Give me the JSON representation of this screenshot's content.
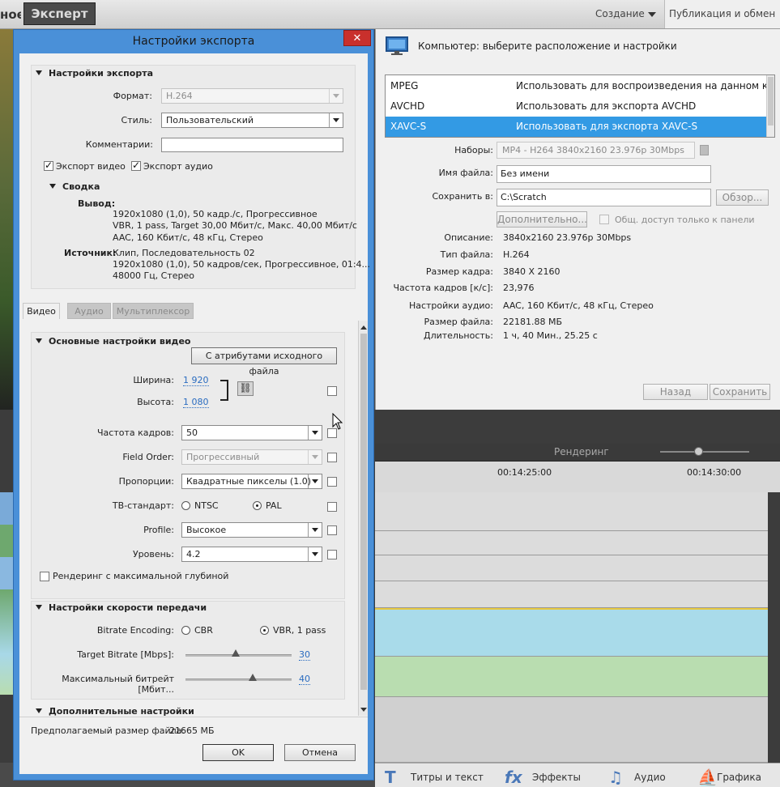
{
  "app": {
    "mode_prev": "ное",
    "mode_expert": "Эксперт",
    "menu_create": "Создание",
    "menu_publish": "Публикация и обмен"
  },
  "publish_panel": {
    "title": "Компьютер: выберите расположение и настройки",
    "presets": [
      {
        "name": "MPEG",
        "desc": "Использовать для воспроизведения на данном компьютере",
        "selected": false
      },
      {
        "name": "AVCHD",
        "desc": "Использовать для экспорта AVCHD",
        "selected": false
      },
      {
        "name": "XAVC-S",
        "desc": "Использовать для экспорта XAVC-S",
        "selected": true
      }
    ],
    "presets_label": "Наборы:",
    "presets_value": "MP4 - H264 3840x2160 23.976p 30Mbps",
    "filename_label": "Имя файла:",
    "filename_value": "Без имени",
    "saveto_label": "Сохранить в:",
    "saveto_value": "C:\\Scratch",
    "browse_button": "Обзор...",
    "advanced_button": "Дополнительно...",
    "share_only_label": "Общ. доступ только к панели",
    "info": [
      {
        "label": "Описание:",
        "value": "3840x2160 23.976p 30Mbps"
      },
      {
        "label": "Тип файла:",
        "value": "H.264"
      },
      {
        "label": "Размер кадра:",
        "value": "3840 X 2160"
      },
      {
        "label": "Частота кадров [к/с]:",
        "value": "23,976"
      },
      {
        "label": "Настройки аудио:",
        "value": "AAC, 160 Кбит/с, 48 кГц, Стерео"
      },
      {
        "label": "Размер файла:",
        "value": "22181.88 МБ"
      },
      {
        "label": "Длительность:",
        "value": "1 ч, 40 Мин., 25.25 с"
      }
    ],
    "back_button": "Назад",
    "save_button": "Сохранить"
  },
  "timeline": {
    "render_label": "Рендеринг",
    "time_1": "00:14:25:00",
    "time_2": "00:14:30:00"
  },
  "bottom_bar": {
    "titles": "Титры и текст",
    "effects": "Эффекты",
    "audio": "Аудио",
    "graphics": "Графика"
  },
  "dialog": {
    "title": "Настройки экспорта",
    "close": "✕",
    "export_settings_title": "Настройки экспорта",
    "format_label": "Формат:",
    "format_value": "H.264",
    "style_label": "Стиль:",
    "style_value": "Пользовательский",
    "comment_label": "Комментарии:",
    "comment_value": "",
    "export_video_label": "Экспорт видео",
    "export_video_checked": true,
    "export_audio_label": "Экспорт аудио",
    "export_audio_checked": true,
    "summary_title": "Сводка",
    "output_label": "Вывод:",
    "output_lines": [
      "1920x1080 (1,0), 50 кадр./с, Прогрессивное",
      "VBR, 1 pass, Target 30,00 Мбит/с, Макс. 40,00 Мбит/с",
      "AAC, 160 Кбит/с, 48 кГц, Стерео"
    ],
    "source_label": "Источник:",
    "source_lines": [
      "Клип, Последовательность 02",
      "1920x1080 (1,0), 50 кадров/сек, Прогрессивное, 01:4...",
      "48000 Гц, Стерео"
    ],
    "tabs": [
      {
        "label": "Видео",
        "active": true
      },
      {
        "label": "Аудио",
        "active": false
      },
      {
        "label": "Мультиплексор",
        "active": false
      }
    ],
    "basic_video_title": "Основные настройки видео",
    "match_source_button": "С атрибутами исходного файла",
    "width_label": "Ширина:",
    "width_value": "1 920",
    "height_label": "Высота:",
    "height_value": "1 080",
    "framerate_label": "Частота кадров:",
    "framerate_value": "50",
    "field_order_label": "Field Order:",
    "field_order_value": "Прогрессивный",
    "aspect_label": "Пропорции:",
    "aspect_value": "Квадратные пикселы (1.0)",
    "tv_standard_label": "ТВ-стандарт:",
    "tv_ntsc": "NTSC",
    "tv_pal": "PAL",
    "tv_selected": "PAL",
    "profile_label": "Profile:",
    "profile_value": "Высокое",
    "level_label": "Уровень:",
    "level_value": "4.2",
    "max_depth_label": "Рендеринг с максимальной глубиной",
    "bitrate_title": "Настройки скорости передачи",
    "bitrate_encoding_label": "Bitrate Encoding:",
    "cbr_label": "CBR",
    "vbr_label": "VBR, 1 pass",
    "bitrate_selected": "VBR, 1 pass",
    "target_bitrate_label": "Target Bitrate [Mbps]:",
    "target_bitrate_value": "30",
    "max_bitrate_label": "Максимальный битрейт [Мбит...",
    "max_bitrate_value": "40",
    "advanced_title": "Дополнительные настройки",
    "estimated_size_label": "Предполагаемый размер файла:",
    "estimated_size_value": "21665 МБ",
    "ok_button": "OK",
    "cancel_button": "Отмена"
  }
}
